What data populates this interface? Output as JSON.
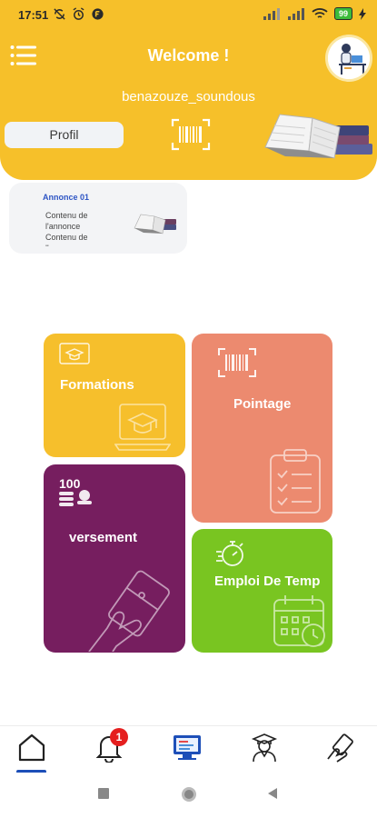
{
  "status_bar": {
    "time": "17:51",
    "battery": "99"
  },
  "header": {
    "title": "Welcome !",
    "username": "benazouze_soundous",
    "profil_label": "Profil"
  },
  "announcement": {
    "title": "Annonce 01",
    "content": "Contenu de l'annonce Contenu de l'annonce"
  },
  "tiles": {
    "formations": "Formations",
    "pointage": "Pointage",
    "versement": "versement",
    "versement_amount": "100",
    "emploi": "Emploi De Temp"
  },
  "bottom_nav": {
    "notification_count": "1",
    "active": "home-icon"
  },
  "colors": {
    "primary": "#f6c02a",
    "formations": "#f6bf2c",
    "pointage": "#ec8a6f",
    "versement": "#761e5f",
    "emploi": "#79c521",
    "accent_blue": "#1d4fb8",
    "badge": "#e51f1f"
  }
}
